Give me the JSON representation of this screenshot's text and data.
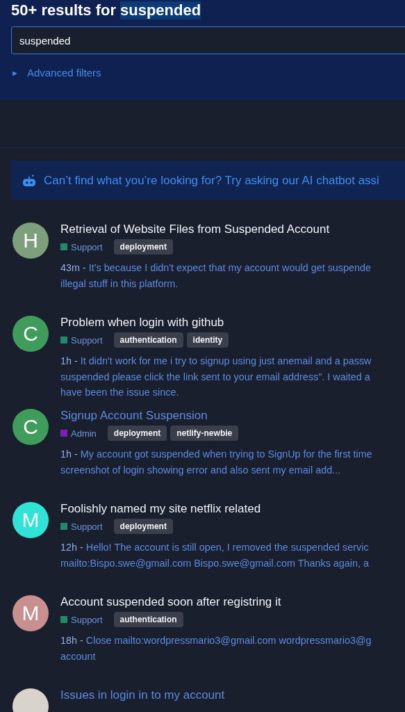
{
  "header": {
    "title_prefix": "50+ results for",
    "query_highlight": "suspended",
    "search": {
      "value": "suspended"
    },
    "advanced_filters": {
      "icon": "►",
      "label": "Advanced filters",
      "expanded": false
    }
  },
  "ai_banner": {
    "text": "Can’t find what you’re looking for? Try asking our AI chatbot assi"
  },
  "results": [
    {
      "avatar": {
        "letter": "H",
        "color": "#7d9f7c"
      },
      "title": "Retrieval of Website Files from Suspended Account",
      "visited": false,
      "category": {
        "name": "Support",
        "color": "#1f8a70"
      },
      "tags": [
        "deployment"
      ],
      "time": "43m -",
      "excerpt_lines": [
        "It's because I didn't expect that my account would get suspende",
        "illegal stuff in this platform."
      ]
    },
    {
      "avatar": {
        "letter": "C",
        "color": "#3f9c5a"
      },
      "title": "Problem when login with github",
      "visited": false,
      "category": {
        "name": "Support",
        "color": "#1f8a70"
      },
      "tags": [
        "authentication",
        "identity"
      ],
      "time": "1h -",
      "excerpt_lines": [
        "It didn't work for me i try to signup using just anemail and a passw",
        "suspended please click the link sent to your email address\". I waited a",
        "have been the issue since."
      ]
    },
    {
      "avatar": {
        "letter": "C",
        "color": "#3f9c5a"
      },
      "title": "Signup Account Suspension",
      "visited": true,
      "category": {
        "name": "Admin",
        "color": "#7a1fb8"
      },
      "tags": [
        "deployment",
        "netlify-newbie"
      ],
      "time": "1h -",
      "excerpt_lines": [
        "My account got suspended when trying to SignUp for the first time",
        "screenshot of login showing error and also sent my email add..."
      ]
    },
    {
      "avatar": {
        "letter": "M",
        "color": "#2fe3d6"
      },
      "title": "Foolishly named my site netflix related",
      "visited": false,
      "category": {
        "name": "Support",
        "color": "#1f8a70"
      },
      "tags": [
        "deployment"
      ],
      "time": "12h -",
      "excerpt_lines": [
        "Hello! The account is still open, I removed the suspended servic",
        "mailto:Bispo.swe@gmail.com Bispo.swe@gmail.com Thanks again, a"
      ]
    },
    {
      "avatar": {
        "letter": "M",
        "color": "#c98f8f"
      },
      "title": "Account suspended soon after registring it",
      "visited": false,
      "category": {
        "name": "Support",
        "color": "#1f8a70"
      },
      "tags": [
        "authentication"
      ],
      "time": "18h -",
      "excerpt_lines": [
        "Close mailto:wordpressmario3@gmail.com wordpressmario3@g",
        "account"
      ]
    },
    {
      "avatar": {
        "color": "#d8d4cc"
      },
      "title": "Issues in login in to my account",
      "visited": true
    }
  ]
}
